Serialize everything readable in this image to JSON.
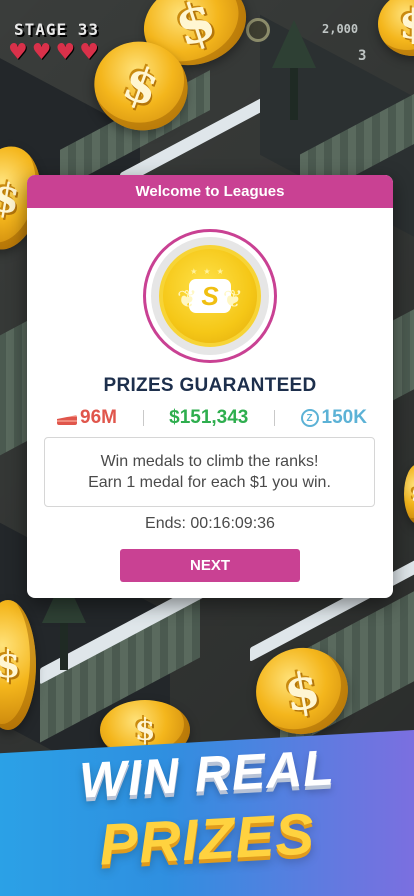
{
  "hud": {
    "stage_label": "STAGE 33",
    "hearts": [
      "♥",
      "♥",
      "♥",
      "♥"
    ],
    "score": "2,000",
    "count": "3"
  },
  "modal": {
    "header_title": "Welcome to Leagues",
    "medal_letter": "S",
    "headline": "PRIZES GUARANTEED",
    "prizes": {
      "cake_value": "96M",
      "cash_value": "$151,343",
      "z_value": "150K"
    },
    "info_line_1": "Win medals to climb the ranks!",
    "info_line_2": "Earn 1 medal for each $1 you win.",
    "ends_text": "Ends: 00:16:09:36",
    "next_label": "NEXT"
  },
  "promo": {
    "line_1": "WIN REAL",
    "line_2": "PRIZES"
  },
  "coin_symbol": "$",
  "colors": {
    "accent": "#c94193",
    "headline": "#1d2f4c",
    "cake": "#e0564c",
    "cash": "#2eae4e",
    "z": "#5cb2d6",
    "promo_yellow": "#ffd23f"
  },
  "icons": {
    "cake": "cake-slice-icon",
    "z": "z-coin-icon",
    "heart": "heart-icon",
    "timer": "stopwatch-icon"
  }
}
